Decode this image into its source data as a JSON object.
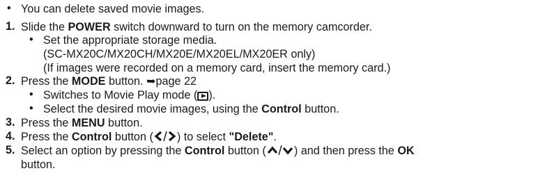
{
  "intro": {
    "bullet": "•",
    "text": "You can delete saved movie images."
  },
  "steps": [
    {
      "num": "1.",
      "pre": "Slide the ",
      "bold": "POWER",
      "post": " switch downward to turn on the memory camcorder.",
      "sub_bullet": "•",
      "sub_lines": [
        "Set the appropriate storage media.",
        "(SC-MX20C/MX20CH/MX20E/MX20EL/MX20ER only)",
        "(If images were recorded on a memory card, insert the memory card.)"
      ]
    },
    {
      "num": "2.",
      "pre": "Press the ",
      "bold": "MODE",
      "post": " button. ",
      "arrow": "➥",
      "page_ref": "page 22",
      "sub1_pre": "Switches to Movie Play mode (",
      "sub1_post": ").",
      "sub2_pre": "Select the desired movie images, using the ",
      "sub2_bold": "Control",
      "sub2_post": " button."
    },
    {
      "num": "3.",
      "pre": "Press the ",
      "bold": "MENU",
      "post": " button."
    },
    {
      "num": "4.",
      "pre": "Press the ",
      "bold": "Control",
      "mid": " button (",
      "post": ") to select ",
      "quote": "\"Delete\"",
      "end": "."
    },
    {
      "num": "5.",
      "pre": "Select an option by pressing the ",
      "bold": "Control",
      "mid": " button (",
      "post": ") and then press the ",
      "bold2": "OK",
      "line2": "button."
    }
  ]
}
